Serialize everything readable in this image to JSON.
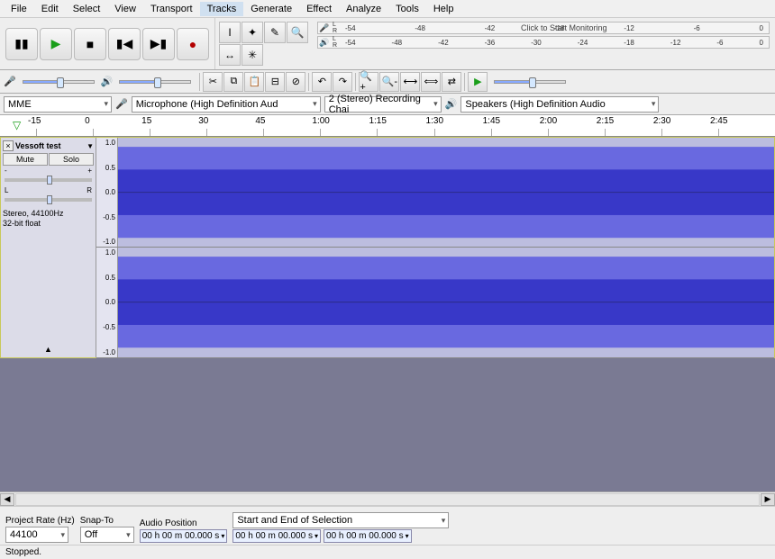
{
  "menu": [
    "File",
    "Edit",
    "Select",
    "View",
    "Transport",
    "Tracks",
    "Generate",
    "Effect",
    "Analyze",
    "Tools",
    "Help"
  ],
  "menu_active": "Tracks",
  "meters": {
    "rec_ticks": [
      "-54",
      "-48",
      "-42",
      "",
      "-18",
      "-12",
      "-6",
      "0"
    ],
    "rec_msg": "Click to Start Monitoring",
    "play_ticks": [
      "-54",
      "-48",
      "-42",
      "-36",
      "-30",
      "-24",
      "-18",
      "-12",
      "-6",
      "0"
    ]
  },
  "devices": {
    "host": "MME",
    "input": "Microphone (High Definition Aud",
    "channels": "2 (Stereo) Recording Chai",
    "output": "Speakers (High Definition Audio"
  },
  "timeline": [
    "-15",
    "0",
    "15",
    "30",
    "45",
    "1:00",
    "1:15",
    "1:30",
    "1:45",
    "2:00",
    "2:15",
    "2:30",
    "2:45"
  ],
  "track": {
    "name": "Vessoft test",
    "mute": "Mute",
    "solo": "Solo",
    "gain": {
      "minus": "-",
      "plus": "+"
    },
    "pan": {
      "l": "L",
      "r": "R"
    },
    "format_line1": "Stereo, 44100Hz",
    "format_line2": "32-bit float",
    "amp_scale": [
      "1.0",
      "0.5",
      "0.0",
      "-0.5",
      "-1.0"
    ]
  },
  "footer": {
    "project_rate_label": "Project Rate (Hz)",
    "project_rate": "44100",
    "snap_label": "Snap-To",
    "snap_value": "Off",
    "audio_pos_label": "Audio Position",
    "audio_pos": "00 h 00 m 00.000 s",
    "sel_label": "Start and End of Selection",
    "sel_start": "00 h 00 m 00.000 s",
    "sel_end": "00 h 00 m 00.000 s"
  },
  "status": "Stopped."
}
